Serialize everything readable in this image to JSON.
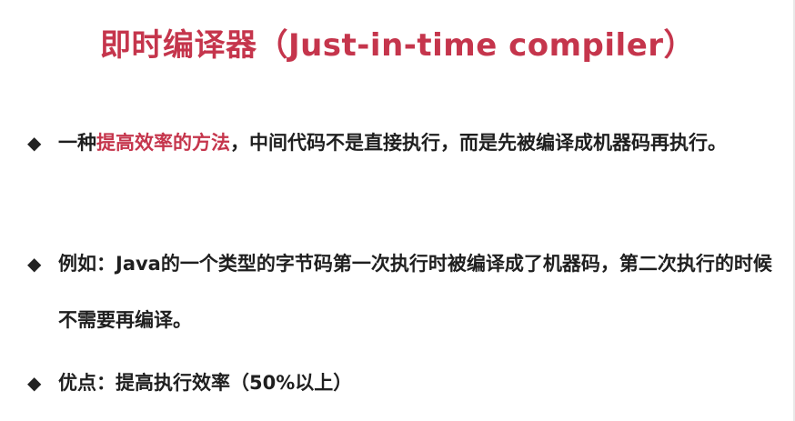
{
  "slide": {
    "title": "即时编译器（Just-in-time compiler）",
    "bullets": [
      {
        "marker": "◆",
        "prefix": "一种",
        "highlight": "提高效率的方法",
        "suffix": "，中间代码不是直接执行，而是先被编译成机器码再执行。"
      },
      {
        "marker": "◆",
        "text": "例如：Java的一个类型的字节码第一次执行时被编译成了机器码，第二次执行的时候不需要再编译。"
      },
      {
        "marker": "◆",
        "text": "优点：提高执行效率（50%以上）"
      }
    ]
  },
  "colors": {
    "accent": "#c5354c",
    "text": "#1f1f1f",
    "background": "#ffffff"
  }
}
